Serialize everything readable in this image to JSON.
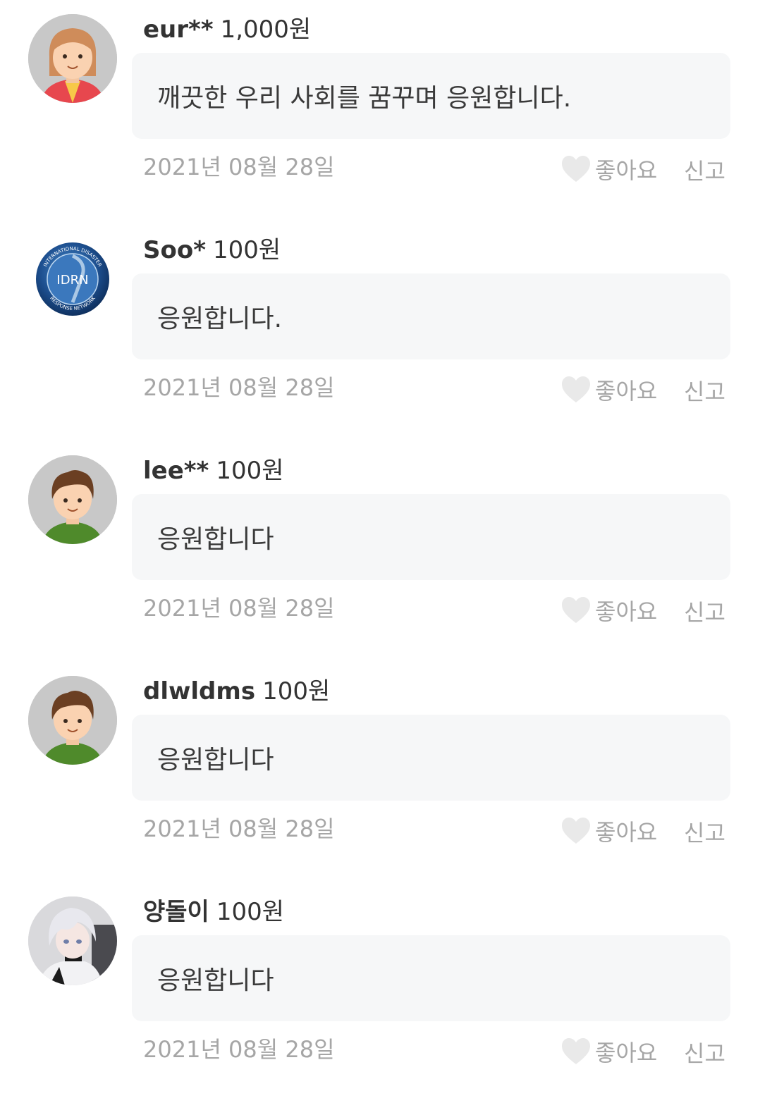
{
  "comments": [
    {
      "avatar": "girl-avatar-icon",
      "username": "eur**",
      "amount": "1,000원",
      "message": "깨끗한 우리 사회를 꿈꾸며 응원합니다.",
      "date": "2021년 08월 28일",
      "like_label": "좋아요",
      "report_label": "신고"
    },
    {
      "avatar": "idrn-logo",
      "logo_text": "IDRN",
      "logo_ring_top": "INTERNATIONAL DISASTER",
      "logo_ring_bottom": "RESPONSE NETWORK",
      "username": "Soo*",
      "amount": "100원",
      "message": "응원합니다.",
      "date": "2021년 08월 28일",
      "like_label": "좋아요",
      "report_label": "신고"
    },
    {
      "avatar": "boy-avatar-icon",
      "username": "lee**",
      "amount": "100원",
      "message": "응원합니다",
      "date": "2021년 08월 28일",
      "like_label": "좋아요",
      "report_label": "신고"
    },
    {
      "avatar": "boy-avatar-icon",
      "username": "dlwldms",
      "amount": "100원",
      "message": "응원합니다",
      "date": "2021년 08월 28일",
      "like_label": "좋아요",
      "report_label": "신고"
    },
    {
      "avatar": "anime-photo-avatar",
      "username": "양돌이",
      "amount": "100원",
      "message": "응원합니다",
      "date": "2021년 08월 28일",
      "like_label": "좋아요",
      "report_label": "신고"
    }
  ],
  "colors": {
    "bubble_bg": "#f6f7f8",
    "muted_text": "#a6a6a6",
    "heart": "#e9e9e9",
    "name_text": "#333333"
  }
}
